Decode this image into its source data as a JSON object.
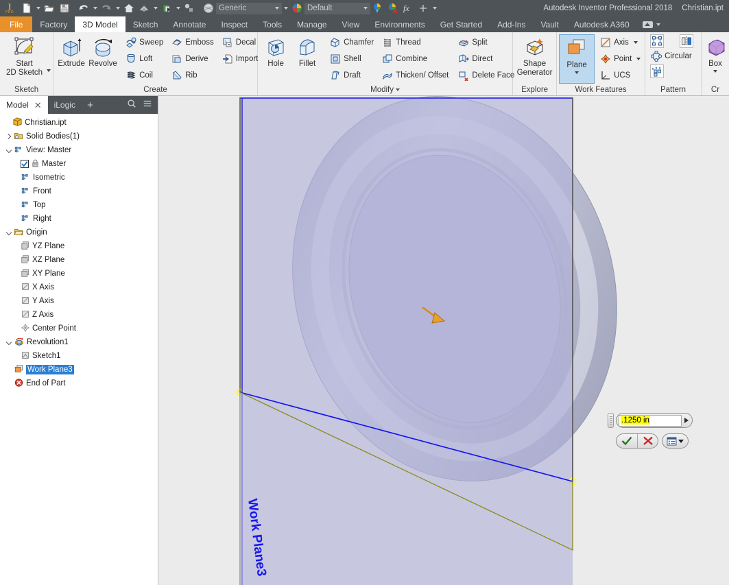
{
  "window": {
    "app_title": "Autodesk Inventor Professional 2018",
    "document_name": "Christian.ipt"
  },
  "quick_access": {
    "logo_main": "I",
    "logo_sub": "PRO",
    "items": [
      {
        "name": "new-document",
        "icon": "new-file-icon"
      },
      {
        "name": "open-document",
        "icon": "open-folder-icon"
      },
      {
        "name": "save-document",
        "icon": "save-disk-icon"
      },
      {
        "name": "undo",
        "icon": "undo-arrow-icon"
      },
      {
        "name": "redo",
        "icon": "redo-arrow-icon"
      },
      {
        "name": "home-view",
        "icon": "home-icon"
      },
      {
        "name": "return",
        "icon": "return-icon"
      },
      {
        "name": "update",
        "icon": "update-green-icon"
      },
      {
        "name": "select",
        "icon": "select-icon"
      },
      {
        "name": "appearance-sphere",
        "icon": "appearance-sphere-icon"
      }
    ],
    "material_value": "Generic",
    "appearance_value": "Default",
    "trailing_items": [
      {
        "name": "adjust-appearance",
        "icon": "paint-bucket-icon"
      },
      {
        "name": "clear-appearance",
        "icon": "clear-appearance-icon"
      },
      {
        "name": "parameters",
        "icon": "fx-icon",
        "label": "fx"
      },
      {
        "name": "add-to-quick-access",
        "icon": "plus-icon",
        "label": "+"
      },
      {
        "name": "customize-quick-access",
        "icon": "chevron-down-icon"
      }
    ]
  },
  "ribbon_tabs": {
    "file_label": "File",
    "tabs": [
      {
        "label": "Factory",
        "active": false
      },
      {
        "label": "3D Model",
        "active": true
      },
      {
        "label": "Sketch",
        "active": false
      },
      {
        "label": "Annotate",
        "active": false
      },
      {
        "label": "Inspect",
        "active": false
      },
      {
        "label": "Tools",
        "active": false
      },
      {
        "label": "Manage",
        "active": false
      },
      {
        "label": "View",
        "active": false
      },
      {
        "label": "Environments",
        "active": false
      },
      {
        "label": "Get Started",
        "active": false
      },
      {
        "label": "Add-Ins",
        "active": false
      },
      {
        "label": "Vault",
        "active": false
      },
      {
        "label": "Autodesk A360",
        "active": false
      }
    ]
  },
  "ribbon_panels": {
    "sketch": {
      "title": "Sketch",
      "buttons": [
        {
          "label": "Start\n2D Sketch",
          "label_line1": "Start",
          "label_line2": "2D Sketch",
          "icon": "start-2d-sketch-icon",
          "has_dropdown": true
        }
      ]
    },
    "create": {
      "title": "Create",
      "big_buttons": [
        {
          "label": "Extrude",
          "icon": "extrude-icon"
        },
        {
          "label": "Revolve",
          "icon": "revolve-icon"
        }
      ],
      "small_col1": [
        {
          "label": "Sweep",
          "icon": "sweep-icon"
        },
        {
          "label": "Loft",
          "icon": "loft-icon"
        },
        {
          "label": "Coil",
          "icon": "coil-icon"
        }
      ],
      "small_col2": [
        {
          "label": "Emboss",
          "icon": "emboss-icon"
        },
        {
          "label": "Derive",
          "icon": "derive-icon"
        },
        {
          "label": "Rib",
          "icon": "rib-icon"
        }
      ],
      "small_col3": [
        {
          "label": "Decal",
          "icon": "decal-icon"
        },
        {
          "label": "Import",
          "icon": "import-icon"
        }
      ]
    },
    "modify": {
      "title": "Modify",
      "has_dropdown": true,
      "big_buttons": [
        {
          "label": "Hole",
          "icon": "hole-icon"
        },
        {
          "label": "Fillet",
          "icon": "fillet-icon"
        }
      ],
      "small_col1": [
        {
          "label": "Chamfer",
          "icon": "chamfer-icon"
        },
        {
          "label": "Shell",
          "icon": "shell-icon"
        },
        {
          "label": "Draft",
          "icon": "draft-icon"
        }
      ],
      "small_col2": [
        {
          "label": "Thread",
          "icon": "thread-icon"
        },
        {
          "label": "Combine",
          "icon": "combine-icon"
        },
        {
          "label": "Thicken/ Offset",
          "icon": "thicken-offset-icon"
        }
      ],
      "small_col3": [
        {
          "label": "Split",
          "icon": "split-icon"
        },
        {
          "label": "Direct",
          "icon": "direct-icon"
        },
        {
          "label": "Delete Face",
          "icon": "delete-face-icon"
        }
      ]
    },
    "explore": {
      "title": "Explore",
      "buttons": [
        {
          "label_line1": "Shape",
          "label_line2": "Generator",
          "icon": "shape-generator-icon"
        }
      ]
    },
    "work_features": {
      "title": "Work Features",
      "plane": {
        "label": "Plane",
        "icon": "work-plane-icon",
        "active": true,
        "has_dropdown": true
      },
      "small": [
        {
          "label": "Axis",
          "icon": "work-axis-icon",
          "has_dropdown": true
        },
        {
          "label": "Point",
          "icon": "work-point-icon",
          "has_dropdown": true
        },
        {
          "label": "UCS",
          "icon": "ucs-icon",
          "has_dropdown": false
        }
      ]
    },
    "pattern": {
      "title": "Pattern",
      "items": [
        {
          "label": "",
          "icon": "rectangular-pattern-icon"
        },
        {
          "label": "",
          "icon": "mirror-icon"
        },
        {
          "label": "Circular",
          "icon": "circular-pattern-icon"
        },
        {
          "label": "",
          "icon": "sketch-driven-pattern-icon"
        }
      ]
    },
    "primitives": {
      "title": "Cr",
      "buttons": [
        {
          "label": "Box",
          "icon": "box-primitive-icon",
          "has_dropdown": true
        }
      ]
    }
  },
  "browser": {
    "tabs": [
      {
        "label": "Model",
        "active": true,
        "closable": true
      },
      {
        "label": "iLogic",
        "active": false,
        "closable": false
      }
    ],
    "add_tab_label": "+",
    "close_glyph": "✕",
    "search_icon": "search-icon",
    "menu_icon": "hamburger-menu-icon",
    "tree": [
      {
        "label": "Christian.ipt",
        "indent": 0,
        "icon": "part-document-icon",
        "expander": "none",
        "selected": false
      },
      {
        "label": "Solid Bodies(1)",
        "indent": 1,
        "icon": "solid-bodies-folder-icon",
        "expander": "collapsed",
        "selected": false
      },
      {
        "label": "View: Master",
        "indent": 1,
        "icon": "view-rep-icon",
        "expander": "expanded",
        "selected": false
      },
      {
        "label": "Master",
        "indent": 2,
        "icon": "lock-icon",
        "expander": "none",
        "checkbox": true,
        "selected": false
      },
      {
        "label": "Isometric",
        "indent": 2,
        "icon": "view-rep-icon",
        "expander": "none",
        "selected": false
      },
      {
        "label": "Front",
        "indent": 2,
        "icon": "view-rep-icon",
        "expander": "none",
        "selected": false
      },
      {
        "label": "Top",
        "indent": 2,
        "icon": "view-rep-icon",
        "expander": "none",
        "selected": false
      },
      {
        "label": "Right",
        "indent": 2,
        "icon": "view-rep-icon",
        "expander": "none",
        "selected": false
      },
      {
        "label": "Origin",
        "indent": 1,
        "icon": "origin-folder-icon",
        "expander": "expanded",
        "selected": false
      },
      {
        "label": "YZ Plane",
        "indent": 2,
        "icon": "origin-plane-icon",
        "expander": "none",
        "selected": false
      },
      {
        "label": "XZ Plane",
        "indent": 2,
        "icon": "origin-plane-icon",
        "expander": "none",
        "selected": false
      },
      {
        "label": "XY Plane",
        "indent": 2,
        "icon": "origin-plane-icon",
        "expander": "none",
        "selected": false
      },
      {
        "label": "X Axis",
        "indent": 2,
        "icon": "origin-axis-icon",
        "expander": "none",
        "selected": false
      },
      {
        "label": "Y Axis",
        "indent": 2,
        "icon": "origin-axis-icon",
        "expander": "none",
        "selected": false
      },
      {
        "label": "Z Axis",
        "indent": 2,
        "icon": "origin-axis-icon",
        "expander": "none",
        "selected": false
      },
      {
        "label": "Center Point",
        "indent": 2,
        "icon": "center-point-icon",
        "expander": "none",
        "selected": false
      },
      {
        "label": "Revolution1",
        "indent": 1,
        "icon": "revolution-feature-icon",
        "expander": "expanded",
        "selected": false
      },
      {
        "label": "Sketch1",
        "indent": 2,
        "icon": "sketch-icon",
        "expander": "none",
        "selected": false
      },
      {
        "label": "Work Plane3",
        "indent": 1,
        "icon": "work-plane-browser-icon",
        "expander": "none",
        "selected": true
      },
      {
        "label": "End of Part",
        "indent": 1,
        "icon": "end-of-part-icon",
        "expander": "none",
        "selected": false
      }
    ]
  },
  "viewport": {
    "plane_label": "Work Plane3",
    "plane_fill_color": "#b1b2da",
    "plane_edge_color": "#1818ee",
    "reference_edge_color": "#8a8a1a",
    "vertex_marker_color": "#ffff00",
    "model_color": "#b9bcd0",
    "background_color": "#ebebeb",
    "direction_arrow_color": "#e09a1e",
    "model_name": "torus-revolution-body"
  },
  "value_input": {
    "value": ".1250 in",
    "highlight_color": "#ffff00",
    "grip_name": "drag-grip",
    "expand_arrow_name": "expand-arrow",
    "ok_label": "✓",
    "cancel_label": "✕",
    "options_name": "options-dropdown"
  }
}
